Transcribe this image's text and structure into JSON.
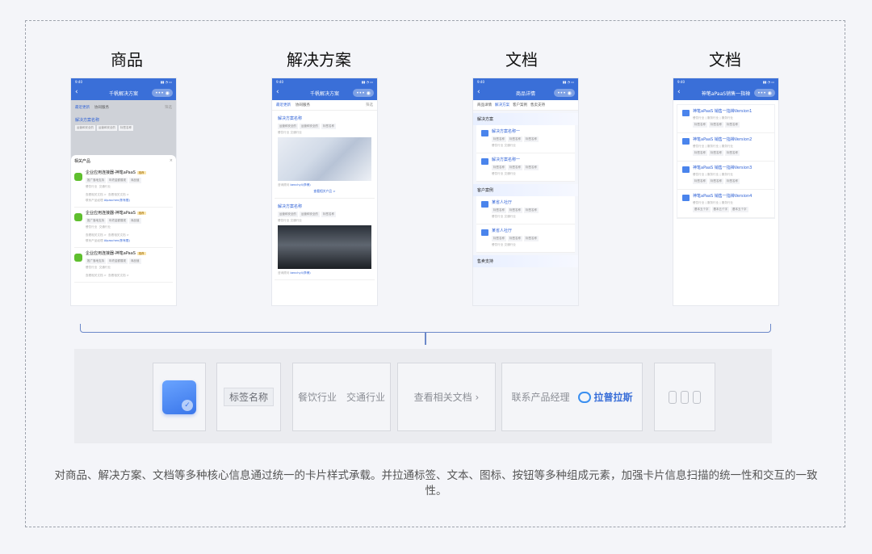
{
  "columns": [
    {
      "title": "商品"
    },
    {
      "title": "解决方案"
    },
    {
      "title": "文档"
    },
    {
      "title": "文档"
    }
  ],
  "phones": {
    "time": "9:40",
    "p1": {
      "nav_title": "千帆解决方案",
      "tabs": [
        "最近更新",
        "协同服务"
      ],
      "filter": "筛选",
      "bg_card_title": "解决方案名称",
      "bg_chips": [
        "运营和安全的",
        "运营和安全的",
        "标签名称"
      ],
      "sheet_title": "相关产品",
      "close": "×",
      "products": [
        {
          "name": "企业应用连接器-神笔aPaaS",
          "badge": "推荐",
          "chips": [
            "推广落地支持",
            "年终金额展现",
            "商品值"
          ],
          "line1": "餐饮行业",
          "line2": "交通行业",
          "doc": "查看相关文档 >",
          "doc2": "查看相关文档 >",
          "contact": "联系产品经理",
          "contact_name": "Alpaschen(陈有限)"
        },
        {
          "name": "企业应用连接器-神笔aPaaS",
          "badge": "推荐",
          "chips": [
            "推广落地支持",
            "年终金额展现",
            "商品值"
          ],
          "line1": "餐饮行业",
          "line2": "交通行业",
          "doc": "查看相关文档 >",
          "doc2": "查看相关文档 >",
          "contact": "联系产品经理",
          "contact_name": "Alpaschen(陈有限)"
        },
        {
          "name": "企业应用连接器-神笔aPaaS",
          "badge": "推荐",
          "chips": [
            "推广落地支持",
            "年终金额展现",
            "商品值"
          ],
          "line1": "餐饮行业",
          "line2": "交通行业",
          "doc": "查看相关文档 >",
          "doc2": "查看相关文档 >"
        }
      ]
    },
    "p2": {
      "nav_title": "千帆解决方案",
      "tabs": [
        "最近更新",
        "协同服务"
      ],
      "filter": "筛选",
      "cards": [
        {
          "title": "解决方案名称",
          "chips": [
            "运营和安全的",
            "运营和安全的",
            "标签名称"
          ],
          "meta": "餐饮行业  交通行业",
          "contact": "咨询顾问",
          "contact_name": "benchyli(李博)",
          "more": "查看相关产品 >"
        },
        {
          "title": "解决方案名称",
          "chips": [
            "运营和安全的",
            "运营和安全的",
            "标签名称"
          ],
          "meta": "餐饮行业  交通行业",
          "contact": "咨询顾问",
          "contact_name": "benchyli(李博)"
        }
      ]
    },
    "p3": {
      "nav_title": "商品详情",
      "tabs": [
        "商品详情",
        "解决方案",
        "客户案例",
        "售卖支持"
      ],
      "sections": [
        {
          "head": "解决方案",
          "items": [
            {
              "title": "解决方案名称一",
              "chips": [
                "标签名称",
                "标签名称",
                "标签名称"
              ],
              "meta": "餐饮行业  交通行业"
            },
            {
              "title": "解决方案名称一",
              "chips": [
                "标签名称",
                "标签名称",
                "标签名称"
              ],
              "meta": "餐饮行业  交通行业"
            }
          ]
        },
        {
          "head": "客户案例",
          "items": [
            {
              "title": "某省人社厅",
              "chips": [
                "标签名称",
                "标签名称",
                "标签名称"
              ],
              "meta": "餐饮行业  交通行业"
            },
            {
              "title": "某省人社厅",
              "chips": [
                "标签名称",
                "标签名称",
                "标签名称"
              ],
              "meta": "餐饮行业  交通行业"
            }
          ]
        },
        {
          "head": "售卖支持",
          "items": []
        }
      ]
    },
    "p4": {
      "nav_title": "神笔aPaaS销售一指禅",
      "docs": [
        {
          "title": "神笔aPaaS 销售一指禅Version1",
          "meta": "餐饮行业 | 服务行业 | 服务行业",
          "chips": [
            "标签名称",
            "标签名称",
            "标签名称"
          ]
        },
        {
          "title": "神笔aPaaS 销售一指禅Version2",
          "meta": "餐饮行业 | 服务行业 | 服务行业",
          "chips": [
            "标签名称",
            "标签名称",
            "标签名称"
          ]
        },
        {
          "title": "神笔aPaaS 销售一指禅Version3",
          "meta": "餐饮行业 | 服务行业 | 服务行业",
          "chips": [
            "标签名称",
            "标签名称",
            "标签名称"
          ]
        },
        {
          "title": "神笔aPaaS 销售一指禅Version4",
          "meta": "餐饮行业 | 服务行业 | 服务行业",
          "chips": [
            "基本五个字",
            "基本五个字",
            "基本五个字"
          ]
        }
      ]
    }
  },
  "components": {
    "tag_label": "标签名称",
    "text_a": "餐饮行业",
    "text_b": "交通行业",
    "link": "查看相关文档",
    "contact_label": "联系产品经理",
    "contact_name": "拉普拉斯"
  },
  "description": "对商品、解决方案、文档等多种核心信息通过统一的卡片样式承载。并拉通标签、文本、图标、按钮等多种组成元素，加强卡片信息扫描的统一性和交互的一致性。",
  "colors": {
    "accent": "#3a6fd8",
    "bracket": "#6b88c9"
  }
}
